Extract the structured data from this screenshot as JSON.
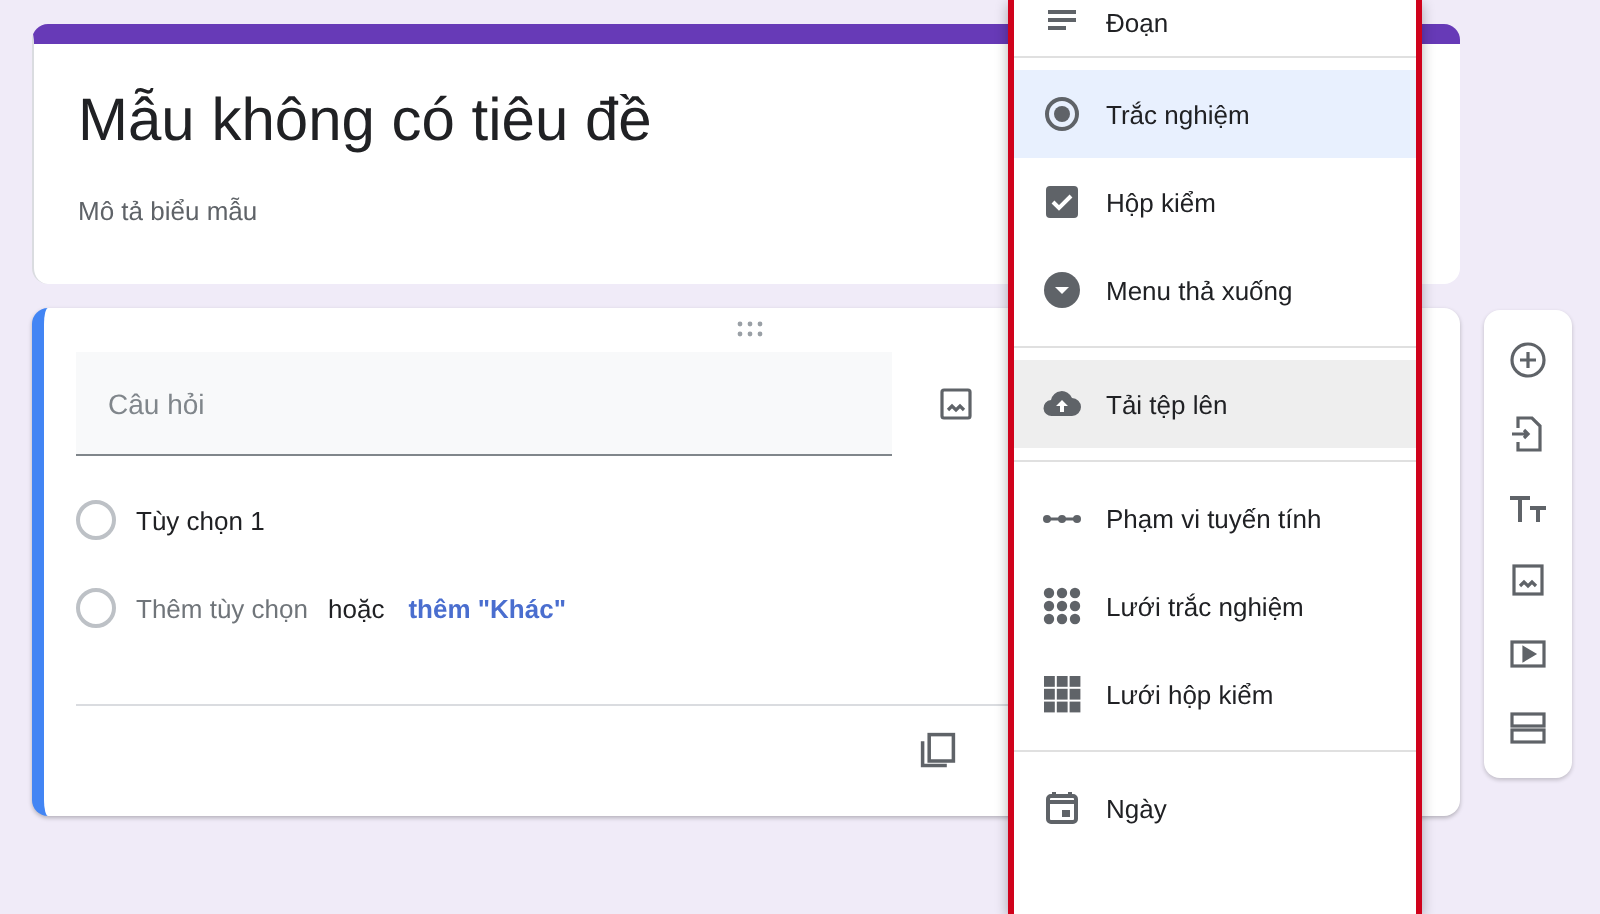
{
  "header_card": {
    "title": "Mẫu không có tiêu đề",
    "description": "Mô tả biểu mẫu"
  },
  "question_card": {
    "question_placeholder": "Câu hỏi",
    "options": [
      {
        "label": "Tùy chọn 1"
      }
    ],
    "add_option": {
      "label": "Thêm tùy chọn",
      "separator": "hoặc",
      "other_link": "thêm \"Khác\""
    }
  },
  "type_menu": {
    "sections": [
      [
        {
          "kind": "paragraph",
          "label": "Đoạn",
          "selected": false,
          "highlighted": false
        }
      ],
      [
        {
          "kind": "radio",
          "label": "Trắc nghiệm",
          "selected": true,
          "highlighted": false
        },
        {
          "kind": "checkbox",
          "label": "Hộp kiểm",
          "selected": false,
          "highlighted": false
        },
        {
          "kind": "dropdown",
          "label": "Menu thả xuống",
          "selected": false,
          "highlighted": false
        }
      ],
      [
        {
          "kind": "upload",
          "label": "Tải tệp lên",
          "selected": false,
          "highlighted": true
        }
      ],
      [
        {
          "kind": "scale",
          "label": "Phạm vi tuyến tính",
          "selected": false,
          "highlighted": false
        },
        {
          "kind": "dotgrid",
          "label": "Lưới trắc nghiệm",
          "selected": false,
          "highlighted": false
        },
        {
          "kind": "boxgrid",
          "label": "Lưới hộp kiểm",
          "selected": false,
          "highlighted": false
        }
      ],
      [
        {
          "kind": "date",
          "label": "Ngày",
          "selected": false,
          "highlighted": false
        }
      ]
    ]
  }
}
